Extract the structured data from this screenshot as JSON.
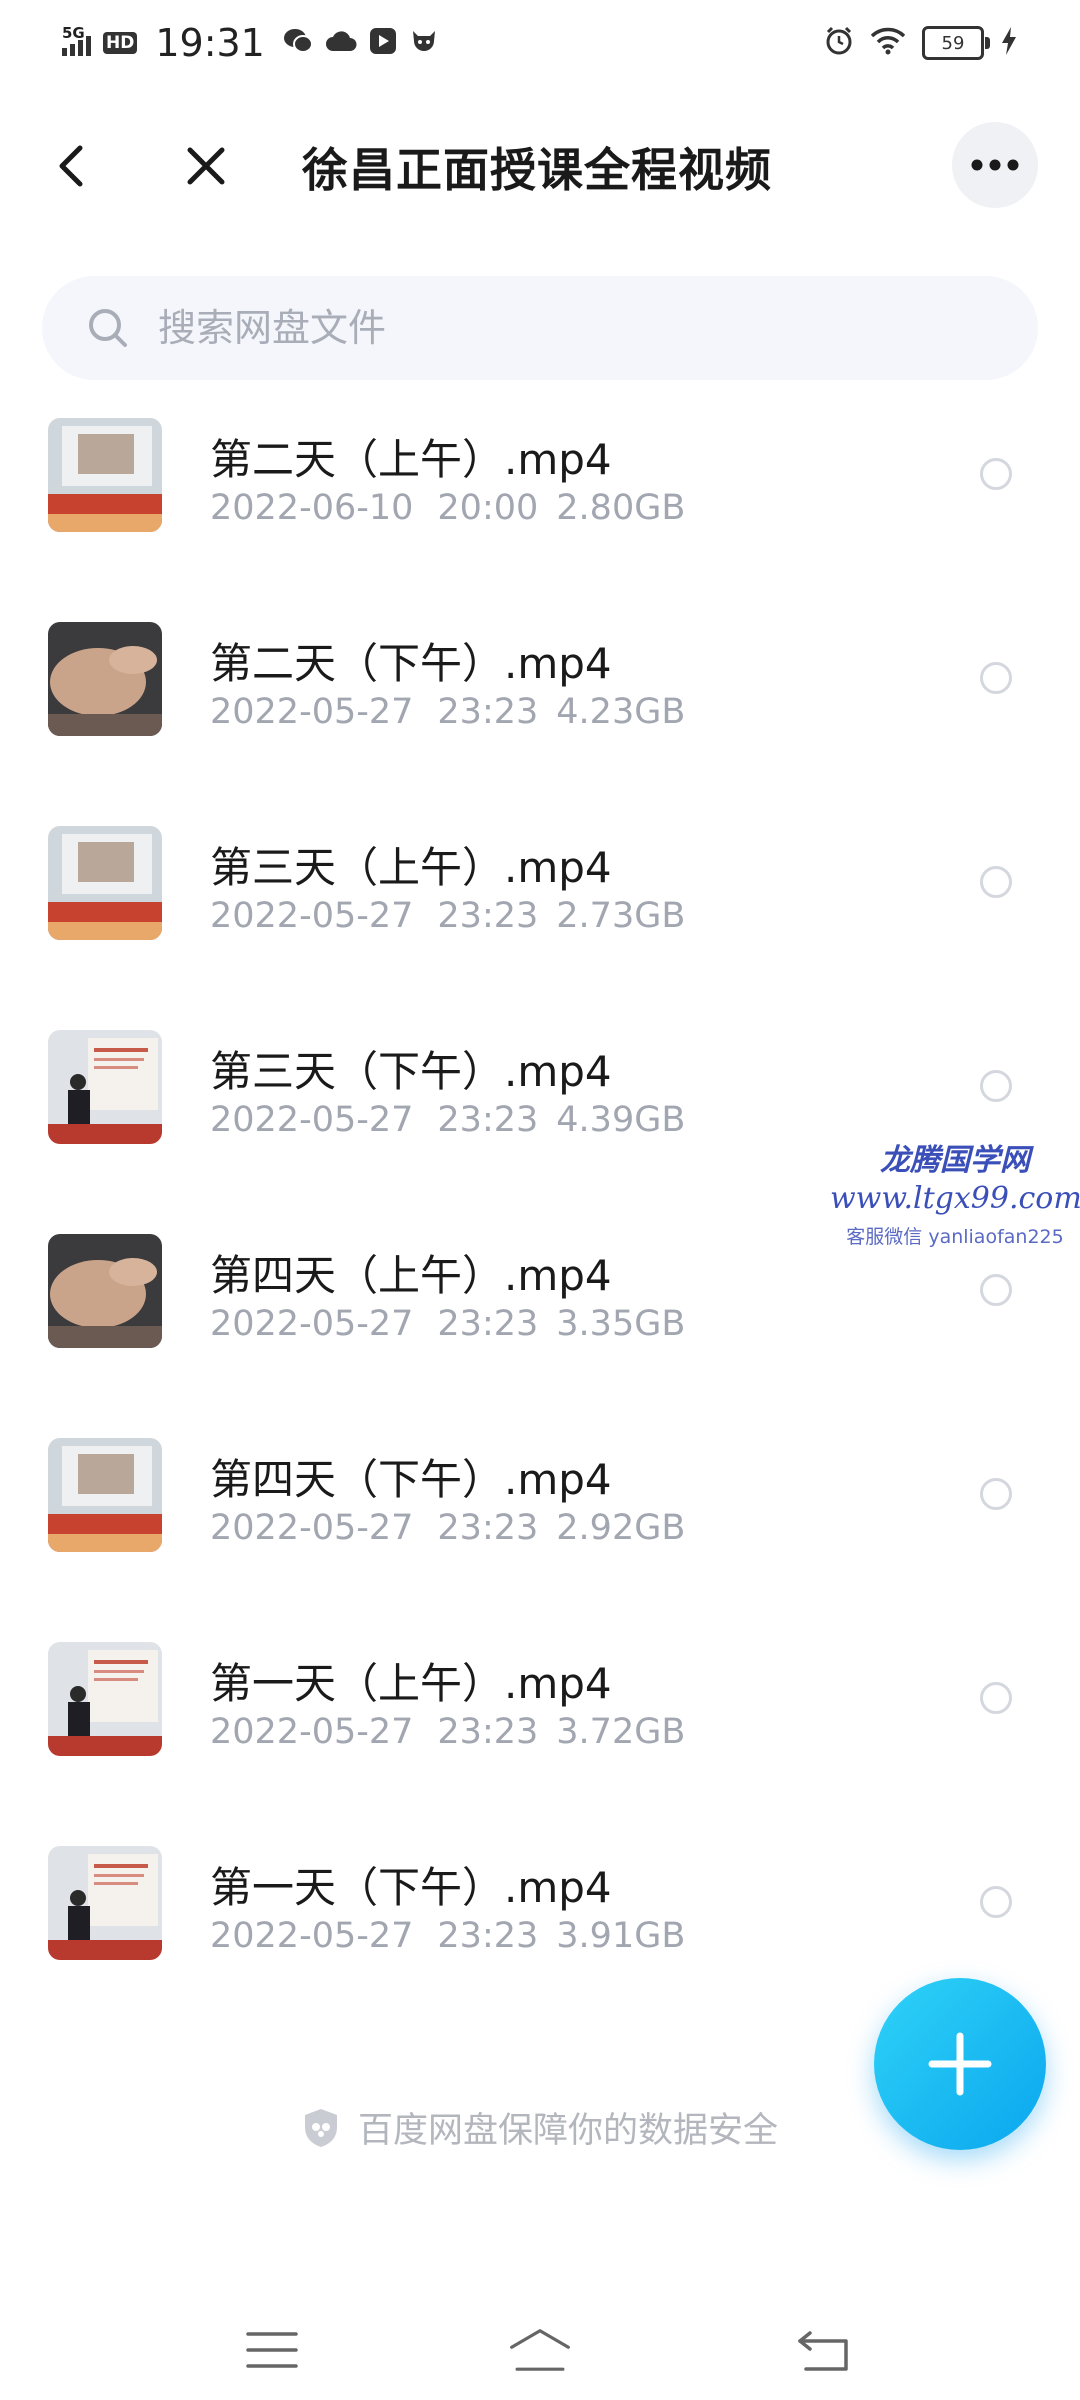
{
  "status_bar": {
    "network": "5G",
    "hd": "HD",
    "time": "19:31",
    "battery": "59"
  },
  "header": {
    "title": "徐昌正面授课全程视频"
  },
  "search": {
    "placeholder": "搜索网盘文件"
  },
  "files": [
    {
      "name": "第二天（上午）.mp4",
      "date": "2022-06-10",
      "time": "20:00",
      "size": "2.80GB",
      "thumb": "classroom-slide"
    },
    {
      "name": "第二天（下午）.mp4",
      "date": "2022-05-27",
      "time": "23:23",
      "size": "4.23GB",
      "thumb": "hands-closeup"
    },
    {
      "name": "第三天（上午）.mp4",
      "date": "2022-05-27",
      "time": "23:23",
      "size": "2.73GB",
      "thumb": "classroom-slide"
    },
    {
      "name": "第三天（下午）.mp4",
      "date": "2022-05-27",
      "time": "23:23",
      "size": "4.39GB",
      "thumb": "classroom-lecturer"
    },
    {
      "name": "第四天（上午）.mp4",
      "date": "2022-05-27",
      "time": "23:23",
      "size": "3.35GB",
      "thumb": "hands-closeup"
    },
    {
      "name": "第四天（下午）.mp4",
      "date": "2022-05-27",
      "time": "23:23",
      "size": "2.92GB",
      "thumb": "classroom-slide"
    },
    {
      "name": "第一天（上午）.mp4",
      "date": "2022-05-27",
      "time": "23:23",
      "size": "3.72GB",
      "thumb": "classroom-lecturer"
    },
    {
      "name": "第一天（下午）.mp4",
      "date": "2022-05-27",
      "time": "23:23",
      "size": "3.91GB",
      "thumb": "classroom-lecturer"
    }
  ],
  "watermark": {
    "title": "龙腾国学网",
    "url": "www.ltgx99.com",
    "contact": "客服微信 yanliaofan225"
  },
  "footer": {
    "security_note": "百度网盘保障你的数据安全"
  },
  "colors": {
    "accent": "#0aa6ee",
    "meta_text": "#a2a6b0",
    "search_bg": "#f4f6fb"
  }
}
